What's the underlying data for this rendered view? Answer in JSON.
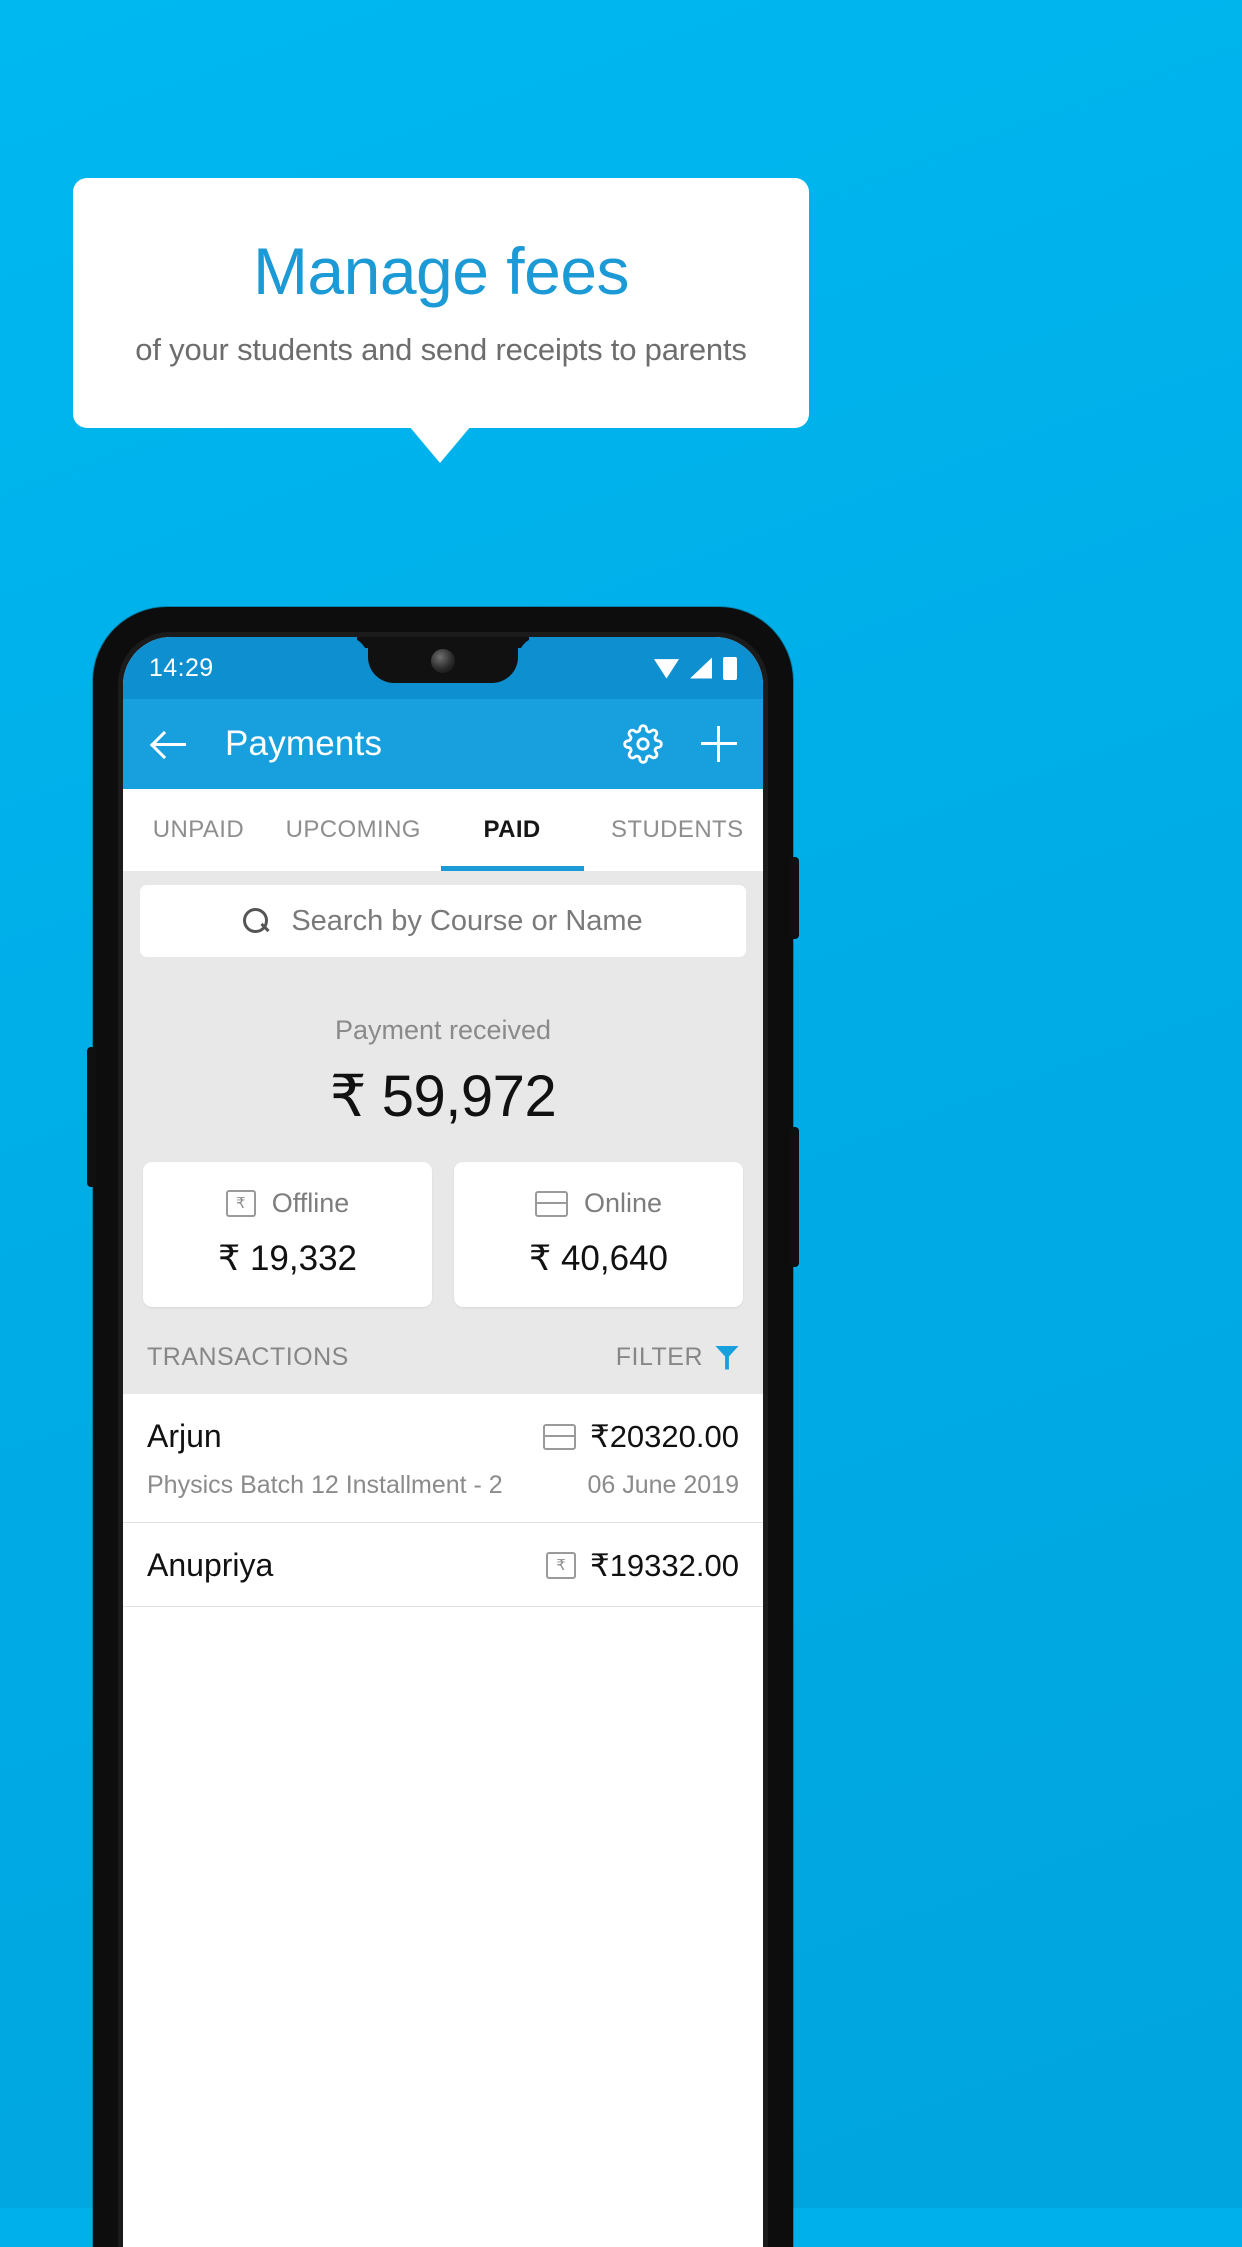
{
  "promo": {
    "headline": "Manage fees",
    "subline": "of your students and send receipts to parents",
    "headline_color": "#1b9ad6",
    "background_color": "#00ade7"
  },
  "status_bar": {
    "time": "14:29",
    "icons": [
      "wifi-icon",
      "signal-icon",
      "battery-icon"
    ]
  },
  "appbar": {
    "back_label": "back-arrow-icon",
    "title": "Payments",
    "settings_label": "gear-icon",
    "add_label": "plus-icon",
    "color": "#17a0dd"
  },
  "tabs": [
    {
      "label": "UNPAID",
      "active": false
    },
    {
      "label": "UPCOMING",
      "active": false
    },
    {
      "label": "PAID",
      "active": true
    },
    {
      "label": "STUDENTS",
      "active": false
    }
  ],
  "search": {
    "placeholder": "Search by Course or Name",
    "value": ""
  },
  "summary": {
    "label": "Payment received",
    "amount": "₹ 59,972"
  },
  "totals": [
    {
      "icon": "offline-receipt-icon",
      "label": "Offline",
      "amount": "₹ 19,332"
    },
    {
      "icon": "credit-card-icon",
      "label": "Online",
      "amount": "₹ 40,640"
    }
  ],
  "transactions_header": {
    "title": "TRANSACTIONS",
    "filter_label": "FILTER",
    "filter_icon": "funnel-icon",
    "filter_color": "#17a0dd"
  },
  "transactions": [
    {
      "name": "Arjun",
      "icon": "credit-card-icon",
      "amount": "₹20320.00",
      "description": "Physics Batch 12 Installment - 2",
      "date": "06 June 2019"
    },
    {
      "name": "Anupriya",
      "icon": "offline-receipt-icon",
      "amount": "₹19332.00",
      "description": "",
      "date": ""
    }
  ]
}
